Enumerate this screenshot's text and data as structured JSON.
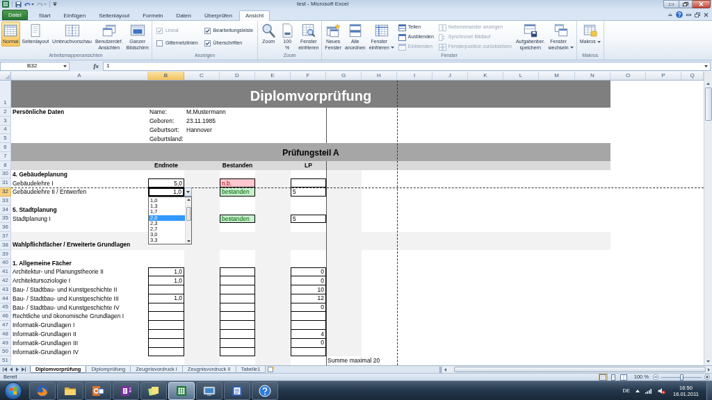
{
  "window": {
    "title": "test - Microsoft Excel"
  },
  "ribbon": {
    "tabs": [
      {
        "label": "Datei",
        "kind": "file",
        "selected": false
      },
      {
        "label": "Start",
        "kind": "tab",
        "selected": false
      },
      {
        "label": "Einfügen",
        "kind": "tab",
        "selected": false
      },
      {
        "label": "Seitenlayout",
        "kind": "tab",
        "selected": false
      },
      {
        "label": "Formeln",
        "kind": "tab",
        "selected": false
      },
      {
        "label": "Daten",
        "kind": "tab",
        "selected": false
      },
      {
        "label": "Überprüfen",
        "kind": "tab",
        "selected": false
      },
      {
        "label": "Ansicht",
        "kind": "tab",
        "selected": true
      }
    ],
    "groups": [
      {
        "label": "Arbeitsmappenansichten",
        "items": [
          {
            "kind": "large",
            "label": "Normal",
            "selected": true
          },
          {
            "kind": "large",
            "label": "Seitenlayout",
            "selected": false
          },
          {
            "kind": "large",
            "label": "Umbruchvorschau",
            "selected": false
          },
          {
            "kind": "large",
            "label": "Benutzerdef. Ansichten",
            "selected": false
          },
          {
            "kind": "large",
            "label": "Ganzer Bildschirm",
            "selected": false
          }
        ]
      },
      {
        "label": "Anzeigen",
        "items": [
          {
            "kind": "checkbox",
            "label": "Lineal",
            "checked": true,
            "disabled": true
          },
          {
            "kind": "checkbox",
            "label": "Gitternetzlinien",
            "checked": false,
            "disabled": false
          },
          {
            "kind": "checkbox",
            "label": "Bearbeitungsleiste",
            "checked": true,
            "disabled": false
          },
          {
            "kind": "checkbox",
            "label": "Überschriften",
            "checked": true,
            "disabled": false
          }
        ]
      },
      {
        "label": "Zoom",
        "items": [
          {
            "kind": "large",
            "label": "Zoom"
          },
          {
            "kind": "large",
            "label": "100 %"
          },
          {
            "kind": "large",
            "label": "Fenster einfrieren"
          }
        ]
      },
      {
        "label": "Fenster",
        "items": [
          {
            "kind": "large",
            "label": "Neues Fenster",
            "disabled": false,
            "dropdown": false
          },
          {
            "kind": "large",
            "label": "Alle anordnen",
            "disabled": false,
            "dropdown": false
          },
          {
            "kind": "large",
            "label": "Fenster einfrieren",
            "disabled": false,
            "dropdown": true
          },
          {
            "kind": "small",
            "label": "Teilen",
            "disabled": false,
            "dropdown": false
          },
          {
            "kind": "small",
            "label": "Ausblenden",
            "disabled": false,
            "dropdown": false
          },
          {
            "kind": "small",
            "label": "Einblenden",
            "disabled": true,
            "dropdown": false
          },
          {
            "kind": "small",
            "label": "Nebeneinander anzeigen",
            "disabled": true,
            "dropdown": false
          },
          {
            "kind": "small",
            "label": "Synchroner Bildlauf",
            "disabled": true,
            "dropdown": false
          },
          {
            "kind": "small",
            "label": "Fensterposition zurücksetzen",
            "disabled": true,
            "dropdown": false
          },
          {
            "kind": "large",
            "label": "Aufgabenber. speichern",
            "disabled": false,
            "dropdown": false
          },
          {
            "kind": "large",
            "label": "Fenster wechseln",
            "disabled": false,
            "dropdown": true
          }
        ]
      },
      {
        "label": "Makros",
        "items": [
          {
            "kind": "large",
            "label": "Makros",
            "dropdown": true
          }
        ]
      }
    ]
  },
  "formula_bar": {
    "name_box": "B32",
    "function_label": "fx",
    "value": "1"
  },
  "sheet": {
    "columns": [
      {
        "label": "A",
        "selected": false
      },
      {
        "label": "B",
        "selected": true
      },
      {
        "label": "C",
        "selected": false
      },
      {
        "label": "D",
        "selected": false
      },
      {
        "label": "E",
        "selected": false
      },
      {
        "label": "F",
        "selected": false
      },
      {
        "label": "G",
        "selected": false
      },
      {
        "label": "H",
        "selected": false
      },
      {
        "label": "I",
        "selected": false
      },
      {
        "label": "J",
        "selected": false
      },
      {
        "label": "K",
        "selected": false
      },
      {
        "label": "L",
        "selected": false
      },
      {
        "label": "M",
        "selected": false
      },
      {
        "label": "N",
        "selected": false
      },
      {
        "label": "O",
        "selected": false
      },
      {
        "label": "P",
        "selected": false
      },
      {
        "label": "Q",
        "selected": false
      }
    ],
    "rows": [
      {
        "numbers": [
          "1"
        ],
        "selected": false,
        "kind": "title",
        "text": "Diplomvorprüfung"
      },
      {
        "numbers": [
          "2"
        ],
        "selected": false,
        "kind": "info",
        "section": "Persönliche Daten",
        "label": "Name:",
        "value": "M.Mustermann"
      },
      {
        "numbers": [
          "3"
        ],
        "selected": false,
        "kind": "info",
        "label": "Geboren:",
        "value": "23.11.1985"
      },
      {
        "numbers": [
          "4"
        ],
        "selected": false,
        "kind": "info",
        "label": "Geburtsort:",
        "value": "Hannover"
      },
      {
        "numbers": [
          "5"
        ],
        "selected": false,
        "kind": "info",
        "label": "Geburtsland:"
      },
      {
        "numbers": [
          "6",
          "7"
        ],
        "selected": false,
        "kind": "band",
        "text": "Prüfungsteil A"
      },
      {
        "numbers": [
          "8"
        ],
        "selected": false,
        "kind": "header",
        "labels": [
          "Endnote",
          "Bestanden",
          "LP"
        ]
      },
      {
        "numbers": [
          "30"
        ],
        "selected": false,
        "kind": "section",
        "text": "4. Gebäudeplanung"
      },
      {
        "numbers": [
          "31"
        ],
        "selected": false,
        "kind": "subject",
        "name": "Gebäudelehre I",
        "endnote": {
          "boxed": true,
          "value": "5,0"
        },
        "result": {
          "boxed": true,
          "color": "#ffc7ce",
          "value": "n.b."
        },
        "lp": {
          "boxed": true
        }
      },
      {
        "numbers": [
          "32"
        ],
        "selected": true,
        "kind": "subject",
        "name": "Gebäudelehre II / Entwerfen",
        "endnote": {
          "boxed": true,
          "value": "1,0"
        },
        "result": {
          "boxed": true,
          "color": "#c6efce",
          "value": "bestanden"
        },
        "lp": {
          "boxed": true,
          "numeric": false,
          "value": "5"
        }
      },
      {
        "numbers": [
          "33"
        ],
        "selected": false,
        "kind": "empty"
      },
      {
        "numbers": [
          "34"
        ],
        "selected": false,
        "kind": "section",
        "text": "5. Stadtplanung"
      },
      {
        "numbers": [
          "35"
        ],
        "selected": false,
        "kind": "subject",
        "name": "Stadtplanung I",
        "result": {
          "boxed": true,
          "color": "#c6efce",
          "value": "bestanden"
        },
        "lp": {
          "boxed": true,
          "numeric": false,
          "value": "5"
        }
      },
      {
        "numbers": [
          "36"
        ],
        "selected": false,
        "kind": "empty"
      },
      {
        "numbers": [
          "37",
          "38"
        ],
        "selected": false,
        "kind": "group",
        "text": "Wahlpflichtfächer / Erweiterte Grundlagen"
      },
      {
        "numbers": [
          "39"
        ],
        "selected": false,
        "kind": "empty"
      },
      {
        "numbers": [
          "40"
        ],
        "selected": false,
        "kind": "section",
        "text": "1. Allgemeine Fächer"
      },
      {
        "numbers": [
          "41"
        ],
        "selected": false,
        "kind": "subject",
        "name": "Architektur- und Planungstheorie II",
        "endnote": {
          "boxed": true,
          "value": "1,0"
        },
        "result": {
          "boxed": true
        },
        "lp": {
          "boxed": true,
          "numeric": true,
          "value": "0"
        }
      },
      {
        "numbers": [
          "42"
        ],
        "selected": false,
        "kind": "subject",
        "name": "Architektursoziologie I",
        "endnote": {
          "boxed": true,
          "value": "1,0"
        },
        "result": {
          "boxed": true
        },
        "lp": {
          "boxed": true,
          "numeric": true,
          "value": "0"
        }
      },
      {
        "numbers": [
          "43"
        ],
        "selected": false,
        "kind": "subject",
        "name": "Bau- / Stadtbau- und Kunstgeschichte II",
        "endnote": {
          "boxed": true
        },
        "result": {
          "boxed": true
        },
        "lp": {
          "boxed": true,
          "numeric": true,
          "value": "10"
        }
      },
      {
        "numbers": [
          "44"
        ],
        "selected": false,
        "kind": "subject",
        "name": "Bau- / Stadtbau- und Kunstgeschichte III",
        "endnote": {
          "boxed": true,
          "value": "1,0"
        },
        "result": {
          "boxed": true
        },
        "lp": {
          "boxed": true,
          "numeric": true,
          "value": "12"
        }
      },
      {
        "numbers": [
          "45"
        ],
        "selected": false,
        "kind": "subject",
        "name": "Bau- / Stadtbau- und Kunstgeschichte IV",
        "endnote": {
          "boxed": true
        },
        "result": {
          "boxed": true
        },
        "lp": {
          "boxed": true,
          "numeric": true,
          "value": "0"
        }
      },
      {
        "numbers": [
          "46"
        ],
        "selected": false,
        "kind": "subject",
        "name": "Rechtliche und ökonomische Grundlagen I",
        "endnote": {
          "boxed": true
        },
        "result": {
          "boxed": true
        },
        "lp": {
          "boxed": true
        }
      },
      {
        "numbers": [
          "47"
        ],
        "selected": false,
        "kind": "subject",
        "name": "Informatik-Grundlagen I",
        "endnote": {
          "boxed": true
        },
        "result": {
          "boxed": true
        },
        "lp": {
          "boxed": true
        }
      },
      {
        "numbers": [
          "48"
        ],
        "selected": false,
        "kind": "subject",
        "name": "Informatik-Grundlagen II",
        "endnote": {
          "boxed": true
        },
        "result": {
          "boxed": true
        },
        "lp": {
          "boxed": true,
          "numeric": true,
          "value": "4"
        }
      },
      {
        "numbers": [
          "49"
        ],
        "selected": false,
        "kind": "subject",
        "name": "Informatik-Grundlagen III",
        "endnote": {
          "boxed": true
        },
        "result": {
          "boxed": true
        },
        "lp": {
          "boxed": true,
          "numeric": true,
          "value": "0"
        }
      },
      {
        "numbers": [
          "50"
        ],
        "selected": false,
        "kind": "subject",
        "name": "Informatik-Grundlagen IV",
        "endnote": {
          "boxed": true
        },
        "result": {
          "boxed": true
        },
        "lp": {
          "boxed": true
        }
      },
      {
        "numbers": [
          "51"
        ],
        "selected": false,
        "kind": "note",
        "text": "Summe maximal 20"
      }
    ],
    "dropdown": {
      "options": [
        {
          "label": "1,0",
          "selected": false
        },
        {
          "label": "1,3",
          "selected": false
        },
        {
          "label": "1,7",
          "selected": false
        },
        {
          "label": "2,0",
          "selected": true
        },
        {
          "label": "2,3",
          "selected": false
        },
        {
          "label": "2,7",
          "selected": false
        },
        {
          "label": "3,0",
          "selected": false
        },
        {
          "label": "3,3",
          "selected": false
        }
      ]
    }
  },
  "sheet_tabs": [
    {
      "label": "Diplomvorprüfung",
      "selected": true
    },
    {
      "label": "Diplomprüfung",
      "selected": false
    },
    {
      "label": "Zeugnisvordruck I",
      "selected": false
    },
    {
      "label": "Zeugnisvordruck II",
      "selected": false
    },
    {
      "label": "Tabelle1",
      "selected": false
    }
  ],
  "status_bar": {
    "text": "Bereit",
    "views": [
      {
        "selected": true
      },
      {
        "selected": false
      },
      {
        "selected": false
      }
    ],
    "zoom": "100 %",
    "zoom_slider": {
      "level": 0.5
    }
  },
  "taskbar": {
    "apps": [
      {
        "selected": false
      },
      {
        "selected": false
      },
      {
        "selected": false
      },
      {
        "selected": false
      },
      {
        "selected": false
      },
      {
        "selected": true
      },
      {
        "selected": false
      },
      {
        "selected": false
      },
      {
        "selected": false
      }
    ],
    "tray": {
      "language": "DE",
      "time": "16:50",
      "date": "16.01.2011"
    }
  }
}
